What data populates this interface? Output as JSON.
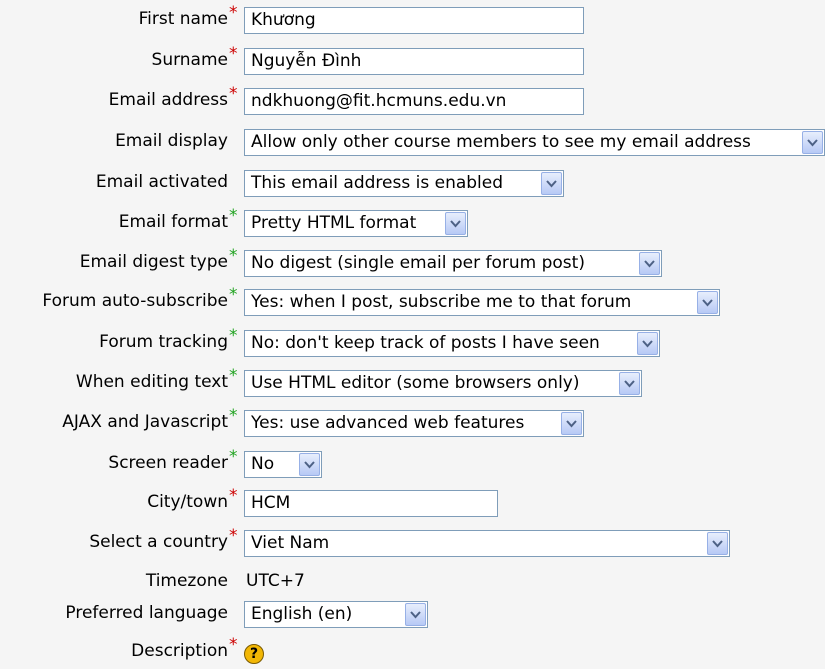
{
  "fields": {
    "first_name": {
      "label": "First name",
      "value": "Khương"
    },
    "surname": {
      "label": "Surname",
      "value": "Nguyễn Đình"
    },
    "email": {
      "label": "Email address",
      "value": "ndkhuong@fit.hcmuns.edu.vn"
    },
    "email_display": {
      "label": "Email display",
      "value": "Allow only other course members to see my email address"
    },
    "email_activated": {
      "label": "Email activated",
      "value": "This email address is enabled"
    },
    "email_format": {
      "label": "Email format",
      "value": "Pretty HTML format"
    },
    "email_digest": {
      "label": "Email digest type",
      "value": "No digest (single email per forum post)"
    },
    "forum_autosubscribe": {
      "label": "Forum auto-subscribe",
      "value": "Yes: when I post, subscribe me to that forum"
    },
    "forum_tracking": {
      "label": "Forum tracking",
      "value": "No: don't keep track of posts I have seen"
    },
    "editing_text": {
      "label": "When editing text",
      "value": "Use HTML editor (some browsers only)"
    },
    "ajax": {
      "label": "AJAX and Javascript",
      "value": "Yes: use advanced web features"
    },
    "screen_reader": {
      "label": "Screen reader",
      "value": "No"
    },
    "city": {
      "label": "City/town",
      "value": "HCM"
    },
    "country": {
      "label": "Select a country",
      "value": "Viet Nam"
    },
    "timezone": {
      "label": "Timezone",
      "value": "UTC+7"
    },
    "language": {
      "label": "Preferred language",
      "value": "English (en)"
    },
    "description": {
      "label": "Description"
    }
  },
  "markers": {
    "required": "*",
    "advanced": "*",
    "help": "?"
  },
  "colors": {
    "required": "#cc0000",
    "advanced": "#21a321",
    "border": "#7f9db9",
    "background": "#f5f5f5"
  }
}
